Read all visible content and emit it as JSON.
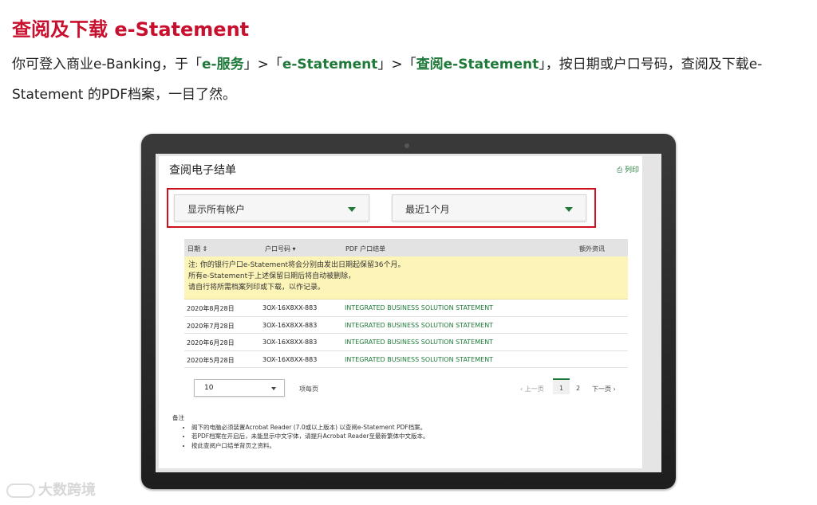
{
  "headline": "查阅及下载 e-Statement",
  "intro": {
    "part1": "你可登入商业e-Banking，于「",
    "link1": "e-服务",
    "part2": "」>「",
    "link2": "e-Statement",
    "part3": "」>「",
    "link3": "查阅e-Statement",
    "part4": "」，按日期或户口号码，查阅及下载e-Statement 的PDF档案，一目了然。"
  },
  "screen": {
    "title": "查阅电子结单",
    "print_label": "⎙ 列印",
    "account_select": "显示所有帐户",
    "period_select": "最近1个月",
    "table": {
      "headers": {
        "date": "日期 ⇕",
        "account": "户口号码 ▾",
        "pdf": "PDF 户口结单",
        "extra": "额外资讯"
      },
      "notice": [
        "注: 你的银行户口e-Statement将会分别由发出日期起保留36个月。",
        "所有e-Statement于上述保留日期后将自动被删除，",
        "请自行将所需档案列印或下载，以作记录。"
      ],
      "rows": [
        {
          "date": "2020年8月28日",
          "account": "3OX-16X8XX-883",
          "statement": "INTEGRATED BUSINESS SOLUTION STATEMENT"
        },
        {
          "date": "2020年7月28日",
          "account": "3OX-16X8XX-883",
          "statement": "INTEGRATED BUSINESS SOLUTION STATEMENT"
        },
        {
          "date": "2020年6月28日",
          "account": "3OX-16X8XX-883",
          "statement": "INTEGRATED BUSINESS SOLUTION STATEMENT"
        },
        {
          "date": "2020年5月28日",
          "account": "3OX-16X8XX-883",
          "statement": "INTEGRATED BUSINESS SOLUTION STATEMENT"
        }
      ]
    },
    "per_page_value": "10",
    "per_page_label": "项每页",
    "pagination": {
      "prev": "‹ 上一页",
      "page1": "1",
      "page2": "2",
      "next": "下一页 ›"
    },
    "notes": {
      "title": "备注",
      "items": [
        "阁下的电脑必须装置Acrobat Reader (7.0或以上版本) 以查阅e-Statement PDF档案。",
        "若PDF档案在开启后，未能显示中文字体，请提升Acrobat Reader至最新繁体中文版本。",
        "按此查阅户口结单背页之资料。"
      ]
    }
  },
  "watermark": "大数跨境",
  "colors": {
    "brand_red": "#c8102e",
    "brand_green": "#1f7a3a",
    "highlight_box": "#d0101e",
    "notice_bg": "#fdf5b8"
  }
}
